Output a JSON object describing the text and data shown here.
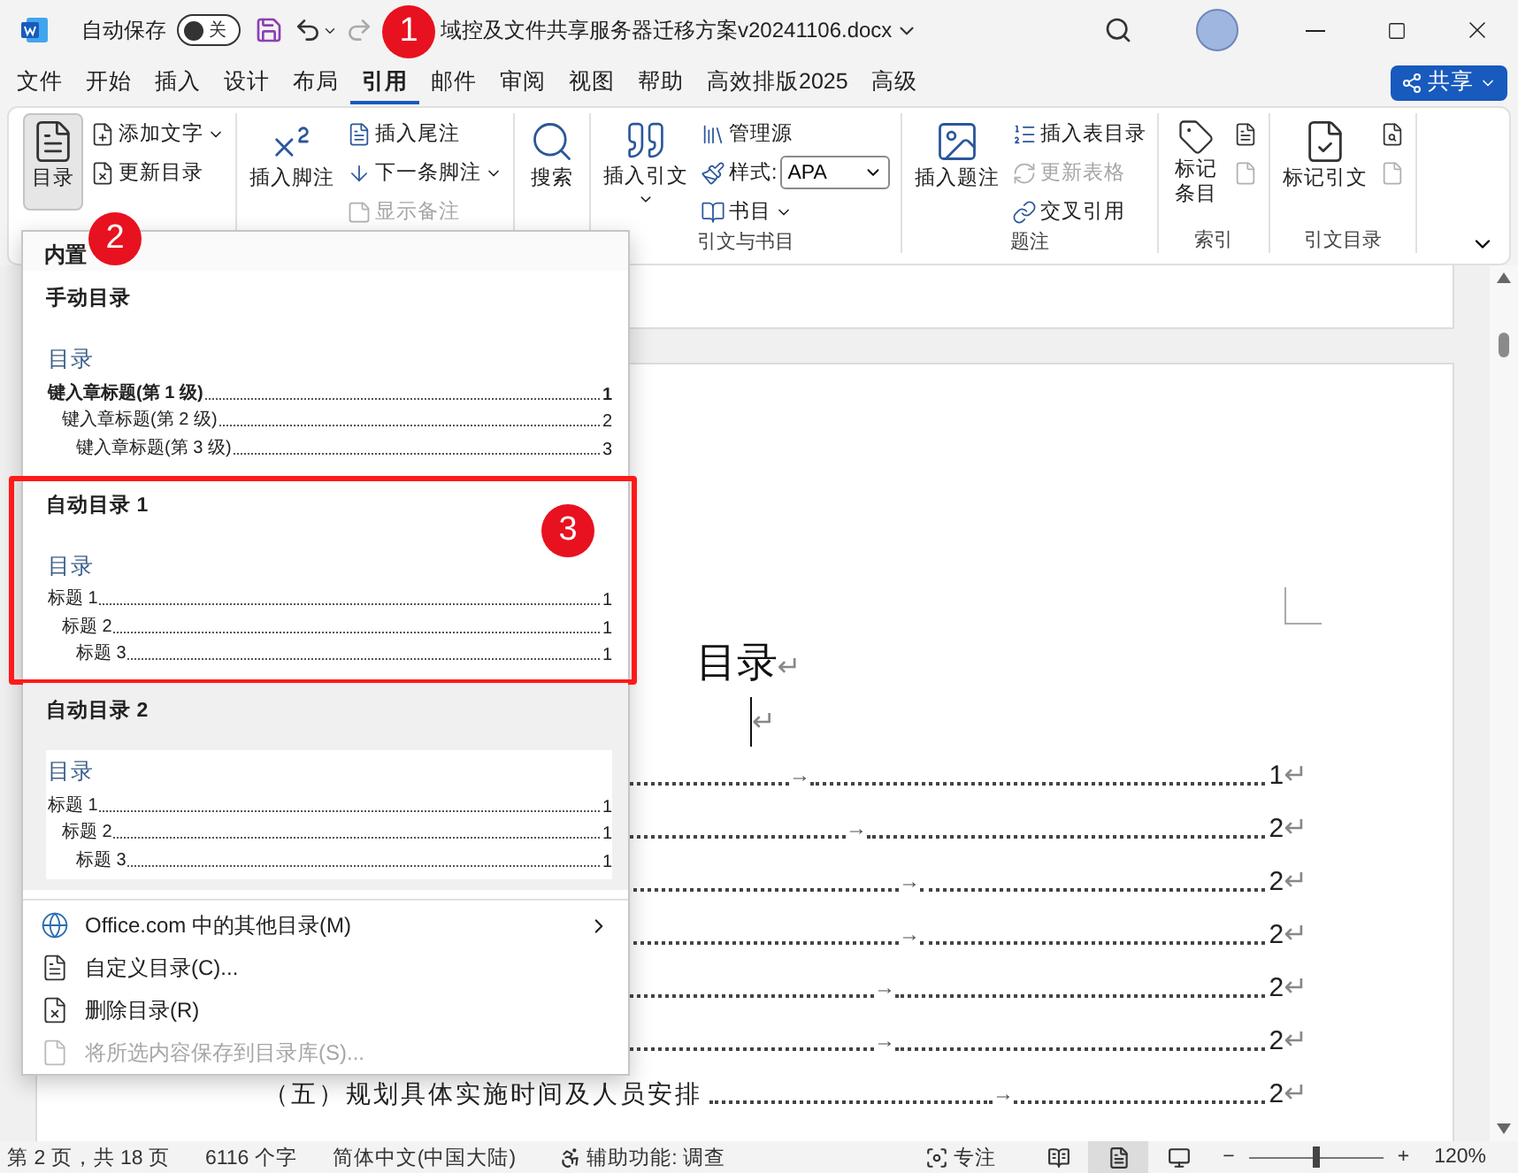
{
  "title_bar": {
    "autosave_label": "自动保存",
    "autosave": {
      "on": false,
      "label": "关"
    },
    "document_title": "域控及文件共享服务器迁移方案v20241106.docx"
  },
  "menu_tabs": [
    {
      "label": "文件",
      "selected": false
    },
    {
      "label": "开始",
      "selected": false
    },
    {
      "label": "插入",
      "selected": false
    },
    {
      "label": "设计",
      "selected": false
    },
    {
      "label": "布局",
      "selected": false
    },
    {
      "label": "引用",
      "selected": true
    },
    {
      "label": "邮件",
      "selected": false
    },
    {
      "label": "审阅",
      "selected": false
    },
    {
      "label": "视图",
      "selected": false
    },
    {
      "label": "帮助",
      "selected": false
    },
    {
      "label": "高效排版2025",
      "selected": false
    },
    {
      "label": "高级",
      "selected": false
    }
  ],
  "share_button": "共享",
  "ribbon": {
    "groups": [
      {
        "items": [
          {
            "kind": "large",
            "label": "目录",
            "pressed": true,
            "disabled": false,
            "dropdown": false
          },
          {
            "kind": "small",
            "label": "添加文字",
            "pressed": false,
            "disabled": false,
            "dropdown": true
          },
          {
            "kind": "small",
            "label": "更新目录",
            "pressed": false,
            "disabled": false,
            "dropdown": false
          }
        ]
      },
      {
        "items": [
          {
            "kind": "large",
            "label": "插入脚注",
            "pressed": false,
            "disabled": false,
            "dropdown": false
          },
          {
            "kind": "small",
            "label": "插入尾注",
            "pressed": false,
            "disabled": false,
            "dropdown": false
          },
          {
            "kind": "small",
            "label": "下一条脚注",
            "pressed": false,
            "disabled": false,
            "dropdown": true
          },
          {
            "kind": "small",
            "label": "显示备注",
            "pressed": false,
            "disabled": true,
            "dropdown": false
          }
        ]
      },
      {
        "items": [
          {
            "kind": "large_narrow",
            "label": "搜索",
            "pressed": false,
            "disabled": false,
            "dropdown": false
          }
        ]
      },
      {
        "label": "引文与书目",
        "items": [
          {
            "kind": "large",
            "label": "插入引文",
            "pressed": false,
            "disabled": false,
            "dropdown": true
          },
          {
            "kind": "small",
            "label": "管理源",
            "pressed": false,
            "disabled": false,
            "dropdown": false
          },
          {
            "kind": "combo",
            "label": "样式:",
            "value": "APA",
            "pressed": false,
            "disabled": false,
            "dropdown": true
          },
          {
            "kind": "small",
            "label": "书目",
            "pressed": false,
            "disabled": false,
            "dropdown": true
          }
        ]
      },
      {
        "label": "题注",
        "items": [
          {
            "kind": "large",
            "label": "插入题注",
            "pressed": false,
            "disabled": false,
            "dropdown": false
          },
          {
            "kind": "small",
            "label": "插入表目录",
            "pressed": false,
            "disabled": false,
            "dropdown": false
          },
          {
            "kind": "small",
            "label": "更新表格",
            "pressed": false,
            "disabled": true,
            "dropdown": false
          },
          {
            "kind": "small",
            "label": "交叉引用",
            "pressed": false,
            "disabled": false,
            "dropdown": false
          }
        ]
      },
      {
        "label": "索引",
        "items": [
          {
            "kind": "large_narrow",
            "label": "标记条目",
            "pressed": false,
            "disabled": false,
            "dropdown": false
          },
          {
            "kind": "icon",
            "pressed": false,
            "disabled": false,
            "dropdown": false
          },
          {
            "kind": "icon",
            "pressed": false,
            "disabled": true,
            "dropdown": false
          }
        ]
      },
      {
        "label": "引文目录",
        "items": [
          {
            "kind": "large",
            "label": "标记引文",
            "pressed": false,
            "disabled": false,
            "dropdown": false
          },
          {
            "kind": "icon",
            "pressed": false,
            "disabled": false,
            "dropdown": false
          },
          {
            "kind": "icon",
            "pressed": false,
            "disabled": true,
            "dropdown": false
          }
        ]
      }
    ]
  },
  "toc_menu": {
    "section_title": "内置",
    "gallery": [
      {
        "title": "手动目录",
        "annotated": false,
        "hovered": false,
        "preview": {
          "heading": "目录",
          "bold_top_level": true,
          "entries": [
            {
              "text": "键入章标题(第 1 级)",
              "page": "1",
              "children": [
                {
                  "text": "键入章标题(第 2 级)",
                  "page": "2",
                  "children": [
                    {
                      "text": "键入章标题(第 3 级)",
                      "page": "3"
                    }
                  ]
                }
              ]
            }
          ]
        }
      },
      {
        "title": "自动目录 1",
        "annotated": true,
        "hovered": false,
        "preview": {
          "heading": "目录",
          "bold_top_level": false,
          "entries": [
            {
              "text": "标题 1",
              "page": "1",
              "children": [
                {
                  "text": "标题 2",
                  "page": "1",
                  "children": [
                    {
                      "text": "标题 3",
                      "page": "1"
                    }
                  ]
                }
              ]
            }
          ]
        }
      },
      {
        "title": "自动目录 2",
        "annotated": false,
        "hovered": true,
        "preview": {
          "heading": "目录",
          "bold_top_level": false,
          "entries": [
            {
              "text": "标题 1",
              "page": "1",
              "children": [
                {
                  "text": "标题 2",
                  "page": "1",
                  "children": [
                    {
                      "text": "标题 3",
                      "page": "1"
                    }
                  ]
                }
              ]
            }
          ]
        }
      }
    ],
    "commands": [
      {
        "label": "Office.com 中的其他目录(M)",
        "submenu": true,
        "disabled": false
      },
      {
        "label": "自定义目录(C)...",
        "submenu": false,
        "disabled": false
      },
      {
        "label": "删除目录(R)",
        "submenu": false,
        "disabled": false
      },
      {
        "label": "将所选内容保存到目录库(S)...",
        "submenu": false,
        "disabled": true
      }
    ]
  },
  "document": {
    "heading": "目录",
    "heading_mark": "↵",
    "cursor_mark": "↵",
    "toc_rows": [
      {
        "tab_mark": "→",
        "page": "1",
        "end_mark": "↵"
      },
      {
        "tab_mark": "→",
        "page": "2",
        "end_mark": "↵"
      },
      {
        "tab_mark": "→",
        "page": "2",
        "end_mark": "↵"
      },
      {
        "tab_mark": "→",
        "page": "2",
        "end_mark": "↵"
      },
      {
        "tab_mark": "→",
        "page": "2",
        "end_mark": "↵"
      },
      {
        "tab_mark": "→",
        "page": "2",
        "end_mark": "↵"
      },
      {
        "title": "（五）规划具体实施时间及人员安排",
        "tab_mark": "→",
        "page": "2",
        "end_mark": "↵"
      }
    ]
  },
  "status_bar": {
    "items": [
      "第 2 页，共 18 页",
      "6116 个字",
      "简体中文(中国大陆)"
    ],
    "accessibility": "辅助功能: 调查",
    "focus": "专注",
    "views": [
      {
        "selected": false
      },
      {
        "selected": true
      },
      {
        "selected": false
      }
    ],
    "zoom": {
      "minus": "−",
      "plus": "+",
      "level": 0.5,
      "percent": "120%"
    }
  },
  "callouts": [
    {
      "number": "1"
    },
    {
      "number": "2"
    },
    {
      "number": "3"
    }
  ]
}
